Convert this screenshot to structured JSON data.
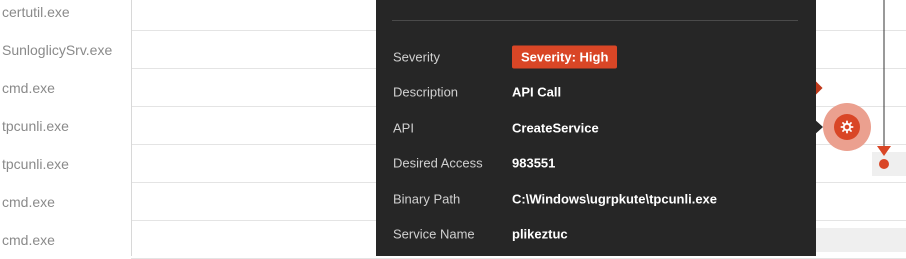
{
  "processes": [
    {
      "name": "certutil.exe"
    },
    {
      "name": "SunloglicySrv.exe"
    },
    {
      "name": "cmd.exe"
    },
    {
      "name": "tpcunli.exe"
    },
    {
      "name": "tpcunli.exe"
    },
    {
      "name": "cmd.exe"
    },
    {
      "name": "cmd.exe"
    }
  ],
  "tooltip": {
    "severity": {
      "label": "Severity",
      "badge": "Severity: High"
    },
    "description": {
      "label": "Description",
      "value": "API Call"
    },
    "api": {
      "label": "API",
      "value": "CreateService"
    },
    "desired_access": {
      "label": "Desired Access",
      "value": "983551"
    },
    "binary_path": {
      "label": "Binary Path",
      "value": "C:\\Windows\\ugrpkute\\tpcunli.exe"
    },
    "service_name": {
      "label": "Service Name",
      "value": "plikeztuc"
    }
  },
  "colors": {
    "event_marker": "#c0391b",
    "marker_dark": "#7a1e10",
    "selected_halo": "#eba08f",
    "selected_core": "#d94626",
    "badge_high": "#d94626",
    "tooltip_bg": "#262626"
  },
  "icons": {
    "event": "gear-icon",
    "selected_event": "gear-icon",
    "branch": "process-branch-icon"
  }
}
